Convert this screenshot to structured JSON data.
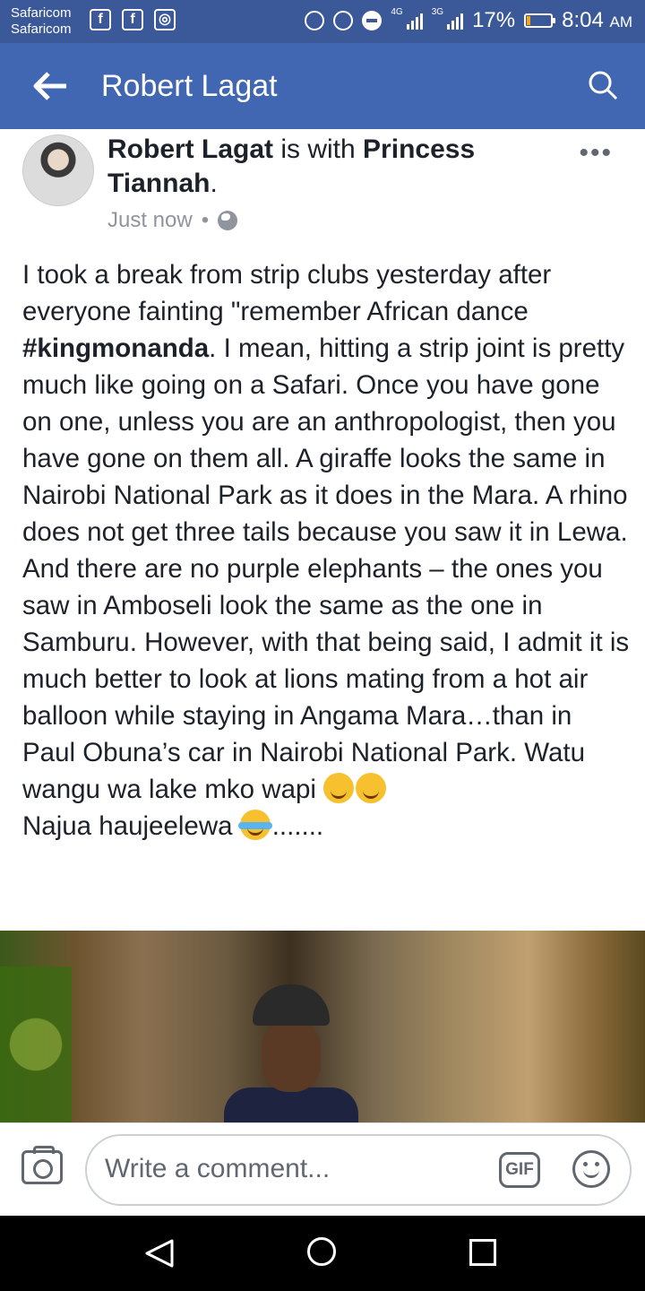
{
  "status_bar": {
    "carrier_1": "Safaricom",
    "carrier_2": "Safaricom",
    "network_1": "4G",
    "network_2": "3G",
    "battery": "17%",
    "time": "8:04",
    "ampm": "AM",
    "battery_level": 0.17,
    "battery_color": "#f5a623"
  },
  "app_bar": {
    "title": "Robert Lagat",
    "color": "#4267b2"
  },
  "post": {
    "author": "Robert Lagat",
    "with_text": " is with ",
    "tagged": "Princess Tiannah",
    "period": ".",
    "time": "Just now",
    "separator": "•",
    "privacy_icon": "globe-icon",
    "paragraphs": [
      "I took a break from strip clubs yesterday after everyone fainting \"remember African dance ",
      ". I mean, hitting a strip joint is pretty much like going on a Safari. Once you have gone on one, unless you are an anthropologist, then you have gone on them all. A giraffe looks the same in Nairobi National Park as it does in the Mara. A rhino does not get three tails because you saw it in Lewa. And there are no purple elephants – the ones you saw in Amboseli look the same as the one in Samburu. However, with that being said, I admit it is much better to look at lions mating from a hot air balloon while staying in Angama Mara…than in Paul Obuna’s car in Nairobi National Park. Watu wangu wa lake mko wapi"
    ],
    "hashtag": "#kingmonanda",
    "last_line": "Najua haujeelewa",
    "trailing": "......."
  },
  "comment_bar": {
    "placeholder": "Write a comment...",
    "gif_label": "GIF"
  }
}
